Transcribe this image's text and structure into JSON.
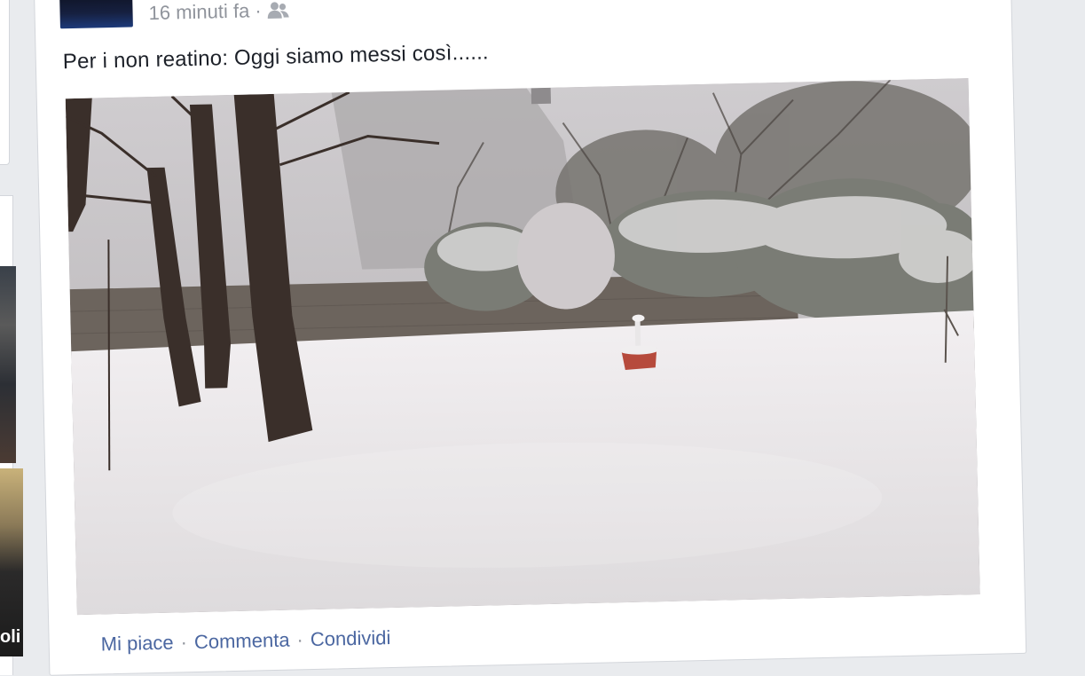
{
  "post": {
    "timestamp": "16 minuti fa",
    "separator": "·",
    "privacy_icon": "friends-icon",
    "text": "Per i non reatino: Oggi siamo messi così......",
    "photo": {
      "subject": "snow-covered-garden",
      "colors": {
        "snow": "#efecee",
        "sky": "#c9c6c8",
        "trunk": "#3a2f2a",
        "wall": "#6a625c",
        "hedge": "#6b6d66",
        "pot": "#a4473a"
      }
    },
    "actions": {
      "like": "Mi piace",
      "comment": "Commenta",
      "share": "Condividi",
      "separator": "·"
    }
  },
  "sidebar": {
    "thumb_text": "oli"
  }
}
